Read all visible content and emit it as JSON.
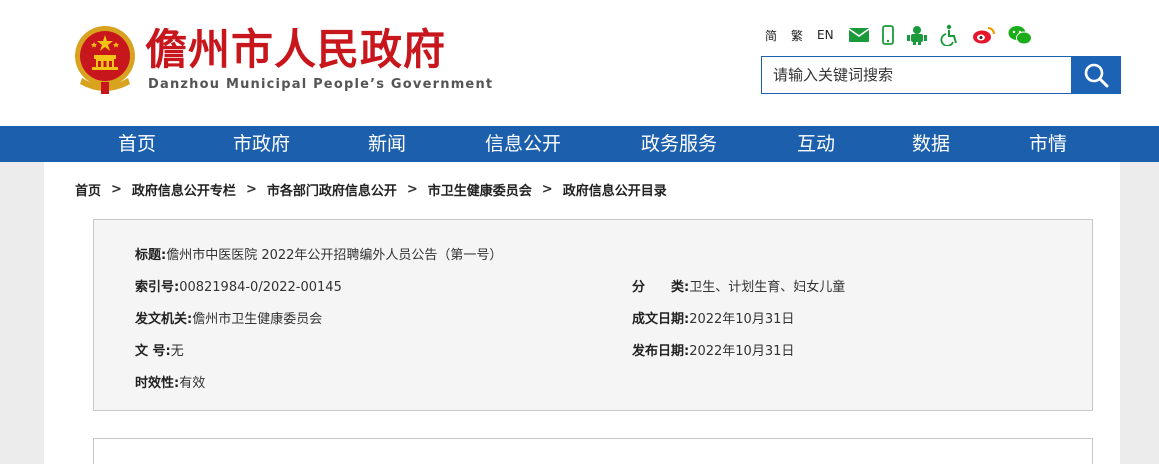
{
  "header": {
    "title_cn": "儋州市人民政府",
    "title_en": "Danzhou Municipal People’s Government",
    "lang_links": [
      "简",
      "繁",
      "EN"
    ],
    "tool_icons": [
      "mail-icon",
      "mobile-icon",
      "robot-icon",
      "accessibility-icon",
      "weibo-icon",
      "wechat-icon"
    ]
  },
  "search": {
    "placeholder": "请输入关键词搜索"
  },
  "nav": {
    "items": [
      "首页",
      "市政府",
      "新闻",
      "信息公开",
      "政务服务",
      "互动",
      "数据",
      "市情"
    ]
  },
  "breadcrumb": {
    "items": [
      "首页",
      "政府信息公开专栏",
      "市各部门政府信息公开",
      "市卫生健康委员会",
      "政府信息公开目录"
    ],
    "separator": ">"
  },
  "meta": {
    "title_label": "标题:",
    "title_value": "儋州市中医医院 2022年公开招聘编外人员公告（第一号）",
    "index_label": "索引号:",
    "index_value": "00821984-0/2022-00145",
    "category_label": "分　　类:",
    "category_value": "卫生、计划生育、妇女儿童",
    "issuer_label": "发文机关:",
    "issuer_value": "儋州市卫生健康委员会",
    "written_label": "成文日期:",
    "written_value": "2022年10月31日",
    "docno_label": "文  号:",
    "docno_value": "无",
    "published_label": "发布日期:",
    "published_value": "2022年10月31日",
    "validity_label": "时效性:",
    "validity_value": "有效"
  },
  "colors": {
    "brand_red": "#c8161d",
    "nav_blue": "#1c5fad",
    "search_blue": "#1c63b6",
    "page_bg": "#ececec",
    "meta_bg": "#f5f5f5"
  }
}
